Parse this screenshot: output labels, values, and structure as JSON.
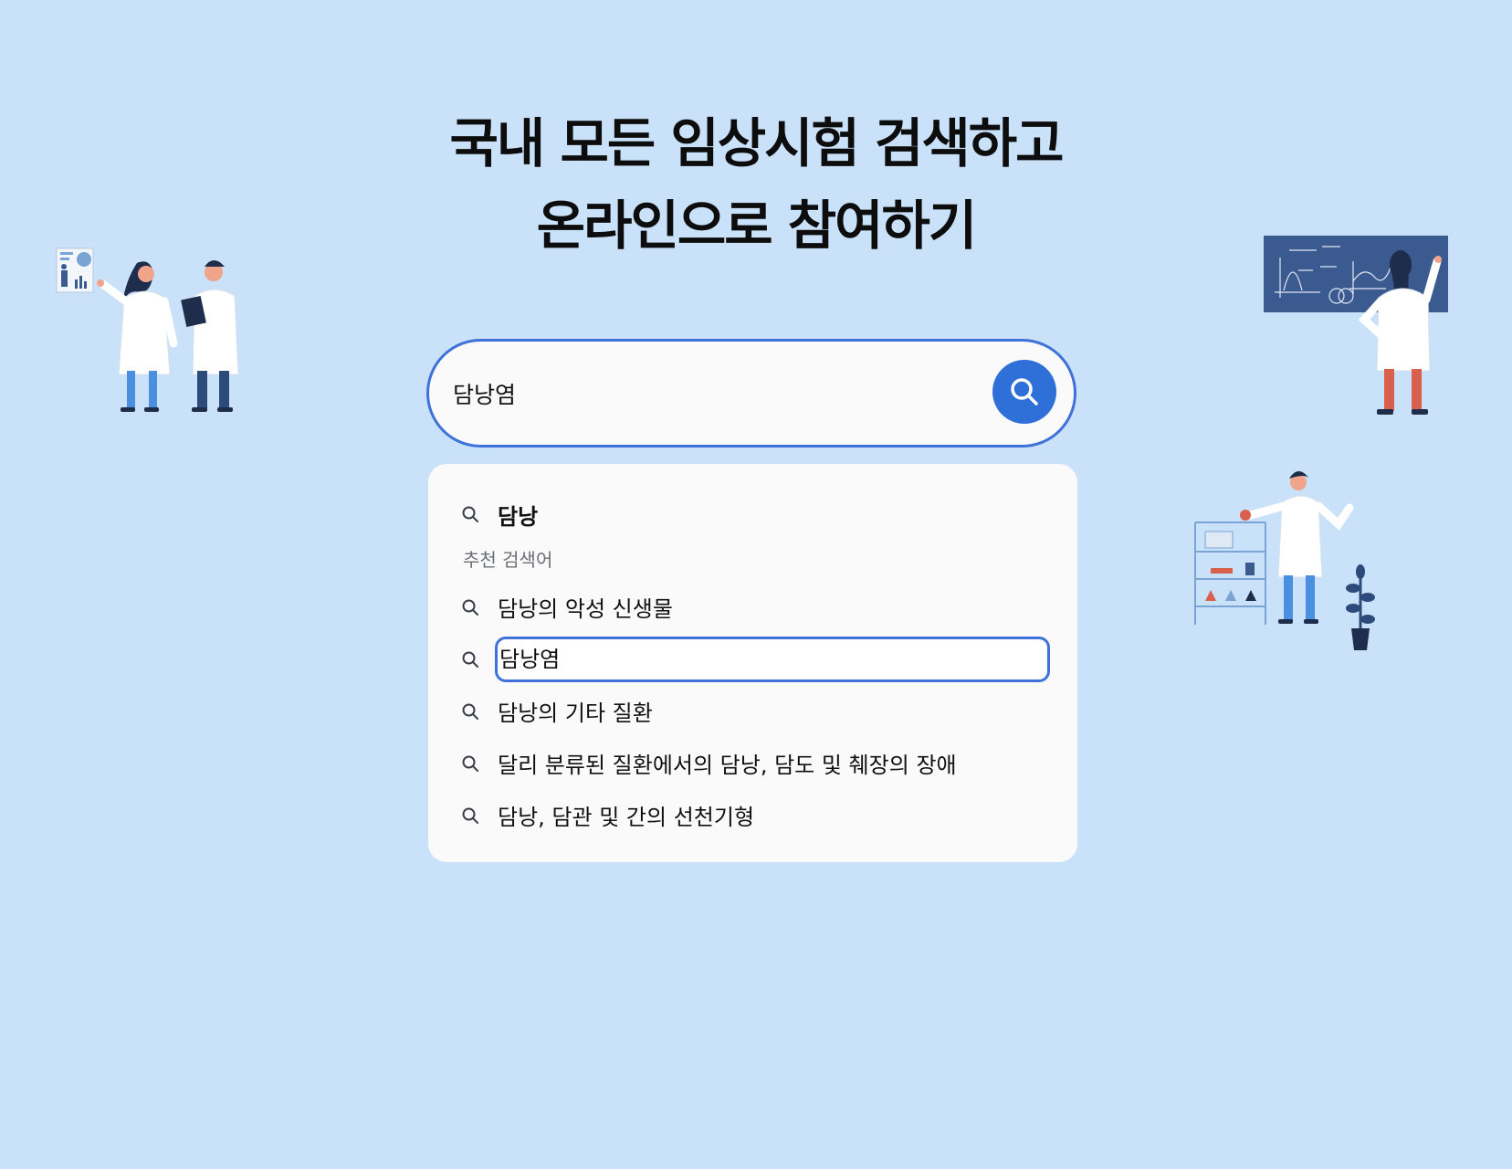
{
  "hero": {
    "line1": "국내 모든 임상시험 검색하고",
    "line2": "온라인으로 참여하기"
  },
  "search": {
    "value": "담낭염",
    "button_icon": "search-icon",
    "accent_color": "#3f72d9",
    "button_color": "#2f6fd8"
  },
  "dropdown": {
    "typed_query": "담낭",
    "section_label": "추천 검색어",
    "suggestions": [
      "담낭의 악성 신생물",
      "담낭염",
      "담낭의 기타 질환",
      "달리 분류된 질환에서의 담낭, 담도 및 췌장의 장애",
      "담낭, 담관 및 간의 선천기형"
    ],
    "active_index": 1
  },
  "colors": {
    "background": "#c9e1f9",
    "panel": "#fafafa",
    "chalkboard": "#3b5a8f",
    "coat": "#ffffff",
    "pants": "#4a8fe0"
  }
}
